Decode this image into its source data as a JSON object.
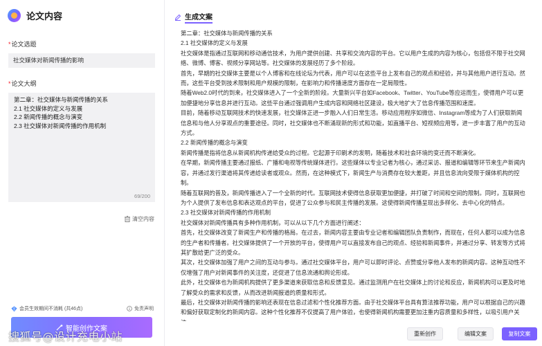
{
  "app": {
    "title": "论文内容"
  },
  "left": {
    "topic_label": "论文选题",
    "topic_value": "社交媒体对新闻传播的影响",
    "outline_label": "论文大纲",
    "outline_lines": [
      "第二章：社交媒体与新闻传播的关系",
      "2.1 社交媒体的定义与发展",
      "2.2 新闻传播的概念与演变",
      "2.3 社交媒体对新闻传播的作用机制"
    ],
    "outline_count": "69/200",
    "clear_label": "清空内容",
    "member_note": "会员生效期间不消耗 (共46点)",
    "disclaimer_label": "免责声明",
    "generate_label": "智能创作文案"
  },
  "right": {
    "title": "生成文案",
    "paragraphs": [
      "第二章：社交媒体与新闻传播的关系",
      "2.1 社交媒体的定义与发展",
      "社交媒体是指通过互联网和移动通信技术，为用户提供创建、共享和交流内容的平台。它以用户生成的内容为核心，包括但不限于社交网络、微博、博客、视频分享网站等。社交媒体的发展经历了多个阶段。",
      "首先，早期的社交媒体主要是以个人博客和在线论坛为代表，用户可以在这些平台上发布自己的观点和经验，并与其他用户进行互动。然而，这些平台受到技术限制和用户规模的限制，在影响力和传播速度方面存在一定局限性。",
      "随着Web2.0时代的到来，社交媒体进入了一个全新的阶段。大量新兴平台如Facebook、Twitter、YouTube等应运而生，使得用户可以更加便捷地分享信息并进行互动。这些平台通过强调用户生成内容和网络社区建设，极大地扩大了信息传播范围和速度。",
      "目前，随着移动互联网技术的快速发展，社交媒体正进一步融入人们日常生活。移动应用程序如微信、Instagram等成为了人们获取新闻信息和与他人分享观点的重要途径。同时，社交媒体也不断涌现新的形式和功能，如直播平台、短视频应用等，进一步丰富了用户的互动方式。",
      "2.2 新闻传播的概念与演变",
      "新闻传播是指将信息从新闻机构传递给受众的过程。它起源于印刷术的发明，随着技术和社会环境的变迁而不断演化。",
      "在早期，新闻传播主要通过报纸、广播和电视等传统媒体进行。这些媒体以专业记者为核心，通过采访、报道和编辑等环节来生产新闻内容，并通过发行渠道将其传递给读者或观众。然而，在这种模式下，新闻生产与消费存在较大差距，并且信息流向受限于媒体机构的控制。",
      "随着互联网的普及，新闻传播进入了一个全新的时代。互联网技术使得信息获取更加便捷，并打破了时间和空间的限制。同时，互联网也为个人提供了发布信息和表达观点的平台，促进了公众参与和民主传播的发展。这使得新闻传播呈现出多样化、去中心化的特点。",
      "2.3 社交媒体对新闻传播的作用机制",
      "社交媒体对新闻传播具有多种作用机制，可以从以下几个方面进行阐述：",
      "首先，社交媒体改变了新闻生产和传播的格局。在过去，新闻内容主要由专业记者和编辑团队负责制作，而现在，任何人都可以成为信息的生产者和传播者。社交媒体提供了一个开放的平台，使得用户可以直接发布自己的观点、经验和新闻事件，并通过分享、转发等方式将其扩散给更广泛的受众。",
      "其次，社交媒体加强了用户之间的互动与参与。通过社交媒体平台，用户可以即时评论、点赞或分享他人发布的新闻内容。这种互动性不仅增强了用户对新闻事件的关注度，还促进了信息流通和舆论形成。",
      "此外，社交媒体也为新闻机构提供了更多渠道来获取信息和反馈意见。通过监测用户在社交媒体上的讨论和反应，新闻机构可以更及时地了解受众的需求和反馈，从而改进新闻报道的质量和形式。",
      "最后，社交媒体对新闻传播的影响还表现在信息过滤和个性化推荐方面。由于社交媒体平台具有算法推荐功能，用户可以根据自己的兴趣和偏好获取定制化的新闻内容。这种个性化推荐不仅提高了用户体验，也使得新闻机构需要更加注重内容质量和多样性，以吸引用户关注。"
    ]
  },
  "footer": {
    "regenerate_label": "重新创作",
    "edit_label": "编辑文案",
    "copy_label": "复制文案"
  },
  "watermark": "搜狐号@设计充电小站",
  "colors": {
    "accent": "#7b61ff",
    "required": "#f5222d",
    "panel_bg": "#f1f1f3"
  },
  "icons": {
    "logo": "app-logo-icon",
    "trash": "trash-icon",
    "diamond": "diamond-icon",
    "info": "info-circle-icon",
    "magic": "magic-wand-icon",
    "edit": "edit-pen-icon"
  }
}
